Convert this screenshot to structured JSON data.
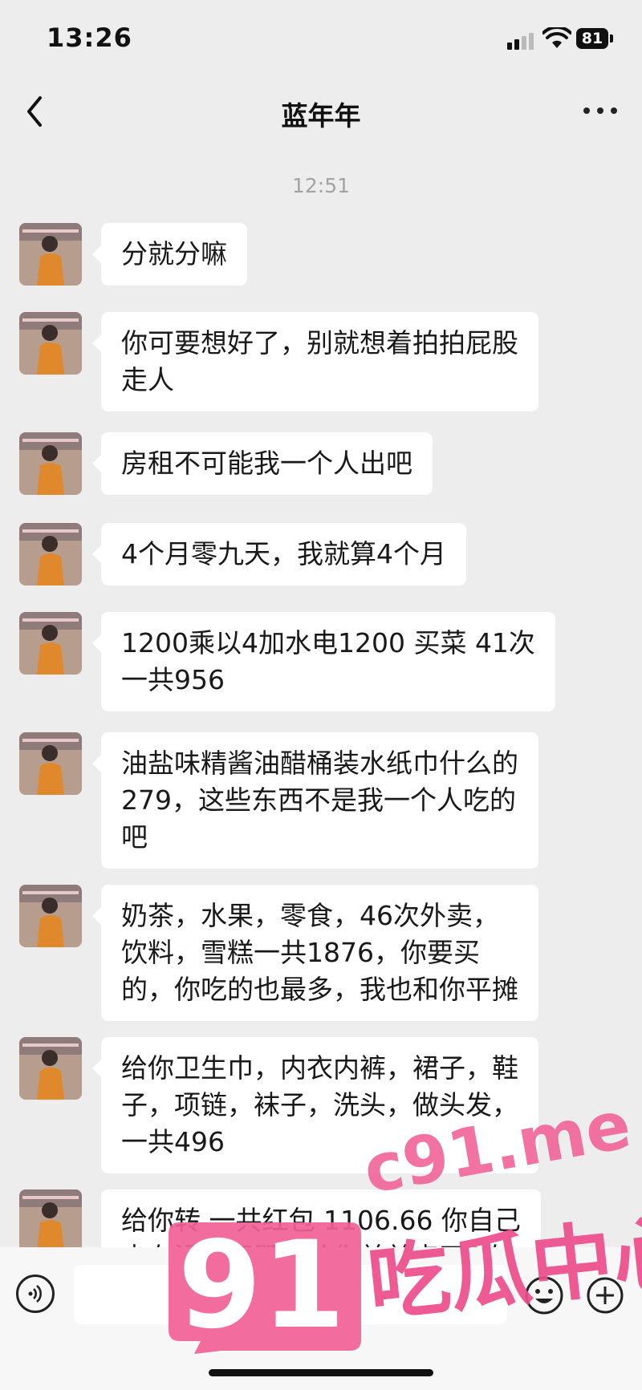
{
  "status_bar": {
    "time": "13:26",
    "battery": "81"
  },
  "header": {
    "title": "蓝年年"
  },
  "chat": {
    "timestamp": "12:51",
    "messages": [
      {
        "lines": [
          "分就分嘛"
        ]
      },
      {
        "lines": [
          "你可要想好了，别就想着拍拍屁股",
          "走人"
        ]
      },
      {
        "lines": [
          "房租不可能我一个人出吧"
        ]
      },
      {
        "lines": [
          "4个月零九天，我就算4个月"
        ]
      },
      {
        "lines": [
          "1200乘以4加水电1200 买菜 41次",
          "一共956"
        ]
      },
      {
        "lines": [
          "油盐味精酱油醋桶装水纸巾什么的",
          "279，这些东西不是我一个人吃的",
          "吧"
        ]
      },
      {
        "lines": [
          "奶茶，水果，零食，46次外卖，",
          "饮料，雪糕一共1876，你要买",
          "的，你吃的也最多，我也和你平摊"
        ]
      },
      {
        "lines": [
          "给你卫生巾，内衣内裤，裙子，鞋",
          "子，项链，袜子，洗头，做头发，",
          "一共496"
        ]
      },
      {
        "lines": [
          "给你转 一共红包 1106.66 你自己",
          "查有没有问题，给你弟弟点了6次"
        ]
      }
    ]
  },
  "watermark": {
    "site": "c91.me",
    "badge_number": "91",
    "slogan": "吃瓜中心"
  },
  "colors": {
    "background": "#ededed",
    "bubble": "#ffffff",
    "watermark_pink": "#f15f96"
  }
}
